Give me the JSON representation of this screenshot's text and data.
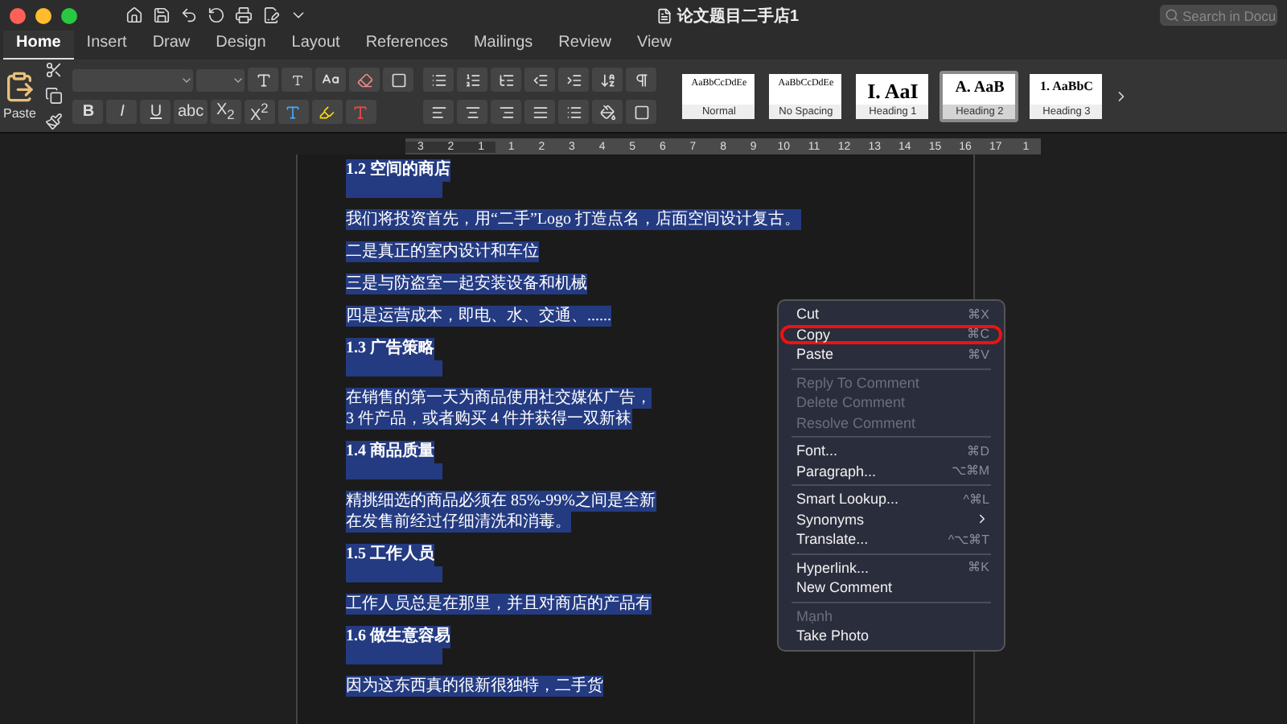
{
  "window": {
    "title": "论文题目二手店1",
    "search": {
      "placeholder": "Search in Docu"
    }
  },
  "tabs": [
    {
      "label": "Home",
      "selected": true
    },
    {
      "label": "Insert",
      "selected": false
    },
    {
      "label": "Draw",
      "selected": false
    },
    {
      "label": "Design",
      "selected": false
    },
    {
      "label": "Layout",
      "selected": false
    },
    {
      "label": "References",
      "selected": false
    },
    {
      "label": "Mailings",
      "selected": false
    },
    {
      "label": "Review",
      "selected": false
    },
    {
      "label": "View",
      "selected": false
    }
  ],
  "ribbon": {
    "paste_label": "Paste",
    "format_buttons": [
      "B",
      "I",
      "U",
      "abc",
      "X$_{2}$",
      "X$^{2}$"
    ],
    "styles": [
      {
        "preview": "AaBbCcDdEe",
        "label": "Normal",
        "kind": "body",
        "selected": false
      },
      {
        "preview": "AaBbCcDdEe",
        "label": "No Spacing",
        "kind": "body",
        "selected": false
      },
      {
        "preview": "I.  AaI",
        "label": "Heading 1",
        "kind": "large",
        "selected": false
      },
      {
        "preview": "A.  AaB",
        "label": "Heading 2",
        "kind": "medium",
        "selected": true
      },
      {
        "preview": "1.  AaBbC",
        "label": "Heading 3",
        "kind": "small",
        "selected": false
      }
    ]
  },
  "ruler": {
    "labels": [
      "3",
      "2",
      "1",
      "1",
      "2",
      "3",
      "4",
      "5",
      "6",
      "7",
      "8",
      "9",
      "10",
      "11",
      "12",
      "13",
      "14",
      "15",
      "16",
      "17",
      "1"
    ]
  },
  "document": {
    "paragraphs": [
      {
        "kind": "heading",
        "text": "1.2 空间的商店",
        "selected": true
      },
      {
        "kind": "body",
        "lines": [
          "我们将投资首先，用“二手”Logo 打造点名，店面空间设计复古。"
        ],
        "selected": true
      },
      {
        "kind": "body",
        "lines": [
          "二是真正的室内设计和车位"
        ],
        "selected": true
      },
      {
        "kind": "body",
        "lines": [
          "三是与防盗室一起安装设备和机械"
        ],
        "selected": true
      },
      {
        "kind": "body",
        "lines": [
          "四是运营成本，即电、水、交通、......"
        ],
        "selected": true
      },
      {
        "kind": "heading",
        "text": "1.3 广告策略",
        "selected": true
      },
      {
        "kind": "body",
        "lines": [
          "在销售的第一天为商品使用社交媒体广告，",
          "3 件产品，或者购买 4 件并获得一双新袜"
        ],
        "selected": true
      },
      {
        "kind": "heading",
        "text": "1.4 商品质量",
        "selected": true
      },
      {
        "kind": "body",
        "lines": [
          "精挑细选的商品必须在 85%-99%之间是全新",
          "在发售前经过仔细清洗和消毒。"
        ],
        "selected": true
      },
      {
        "kind": "heading",
        "text": "1.5 工作人员",
        "selected": true
      },
      {
        "kind": "body",
        "lines": [
          "工作人员总是在那里，并且对商店的产品有"
        ],
        "selected": true
      },
      {
        "kind": "heading",
        "text": "1.6 做生意容易",
        "selected": true
      },
      {
        "kind": "body",
        "lines": [
          "因为这东西真的很新很独特，二手货"
        ],
        "selected": true
      }
    ]
  },
  "context_menu": {
    "items": [
      {
        "kind": "item",
        "label": "Cut",
        "shortcut": "⌘X",
        "disabled": false,
        "highlighted": false
      },
      {
        "kind": "item",
        "label": "Copy",
        "shortcut": "⌘C",
        "disabled": false,
        "highlighted": true
      },
      {
        "kind": "item",
        "label": "Paste",
        "shortcut": "⌘V",
        "disabled": false,
        "highlighted": false
      },
      {
        "kind": "separator"
      },
      {
        "kind": "item",
        "label": "Reply To Comment",
        "disabled": true,
        "highlighted": false
      },
      {
        "kind": "item",
        "label": "Delete Comment",
        "disabled": true,
        "highlighted": false
      },
      {
        "kind": "item",
        "label": "Resolve Comment",
        "disabled": true,
        "highlighted": false
      },
      {
        "kind": "separator"
      },
      {
        "kind": "item",
        "label": "Font...",
        "shortcut": "⌘D",
        "disabled": false,
        "highlighted": false
      },
      {
        "kind": "item",
        "label": "Paragraph...",
        "shortcut": "⌥⌘M",
        "disabled": false,
        "highlighted": false
      },
      {
        "kind": "separator"
      },
      {
        "kind": "item",
        "label": "Smart Lookup...",
        "shortcut": "^⌘L",
        "disabled": false,
        "highlighted": false
      },
      {
        "kind": "submenu",
        "label": "Synonyms",
        "disabled": false,
        "highlighted": false
      },
      {
        "kind": "item",
        "label": "Translate...",
        "shortcut": "^⌥⌘T",
        "disabled": false,
        "highlighted": false
      },
      {
        "kind": "separator"
      },
      {
        "kind": "item",
        "label": "Hyperlink...",
        "shortcut": "⌘K",
        "disabled": false,
        "highlighted": false
      },
      {
        "kind": "item",
        "label": "New Comment",
        "disabled": false,
        "highlighted": false
      },
      {
        "kind": "separator"
      },
      {
        "kind": "item",
        "label": "Mạnh",
        "disabled": true,
        "highlighted": false
      },
      {
        "kind": "item",
        "label": "Take Photo",
        "disabled": false,
        "highlighted": false
      }
    ]
  }
}
